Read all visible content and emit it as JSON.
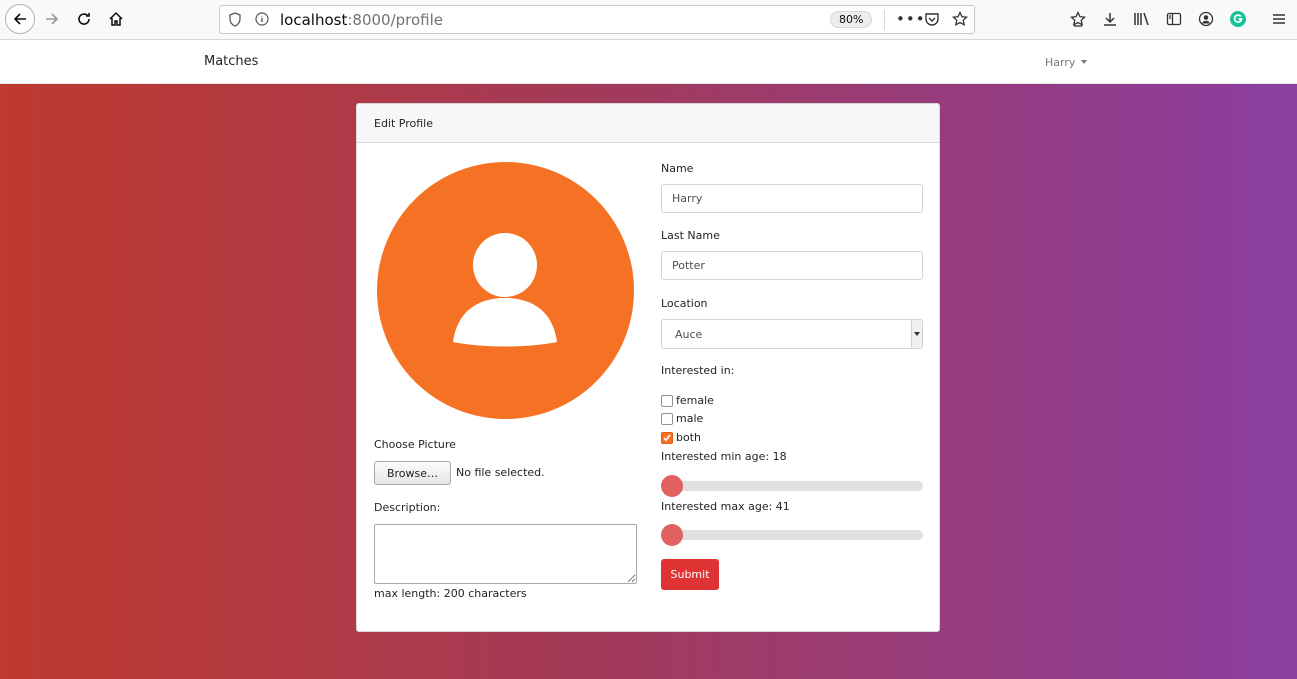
{
  "browser": {
    "url_host": "localhost",
    "url_rest": ":8000/profile",
    "zoom": "80%",
    "icons": [
      "back-icon",
      "forward-icon",
      "reload-icon",
      "home-icon",
      "shield-icon",
      "info-icon",
      "more-icon",
      "pocket-icon",
      "bookmark-star-icon",
      "extensions-icon",
      "download-icon",
      "library-icon",
      "sidebar-icon",
      "account-icon",
      "grammarly-icon",
      "menu-icon"
    ]
  },
  "navbar": {
    "brand": "Matches",
    "user": "Harry"
  },
  "card": {
    "header": "Edit Profile"
  },
  "form": {
    "choose_picture_label": "Choose Picture",
    "browse_label": "Browse…",
    "no_file_text": "No file selected.",
    "description_label": "Description:",
    "description_value": "",
    "description_hint": "max length: 200 characters",
    "name_label": "Name",
    "name_value": "Harry",
    "last_name_label": "Last Name",
    "last_name_value": "Potter",
    "location_label": "Location",
    "location_value": "Auce",
    "interested_label": "Interested in:",
    "interest_options": [
      {
        "label": "female",
        "checked": false
      },
      {
        "label": "male",
        "checked": false
      },
      {
        "label": "both",
        "checked": true
      }
    ],
    "min_age_label": "Interested min age: 18",
    "max_age_label": "Interested max age: 41",
    "min_age_slider": 0.0,
    "max_age_slider": 0.0,
    "submit_label": "Submit"
  },
  "colors": {
    "avatar": "#f57224",
    "submit": "#e03333",
    "slider_thumb": "#e26262",
    "gradient_left": "#bf3a2f",
    "gradient_right": "#8b3fa0"
  }
}
